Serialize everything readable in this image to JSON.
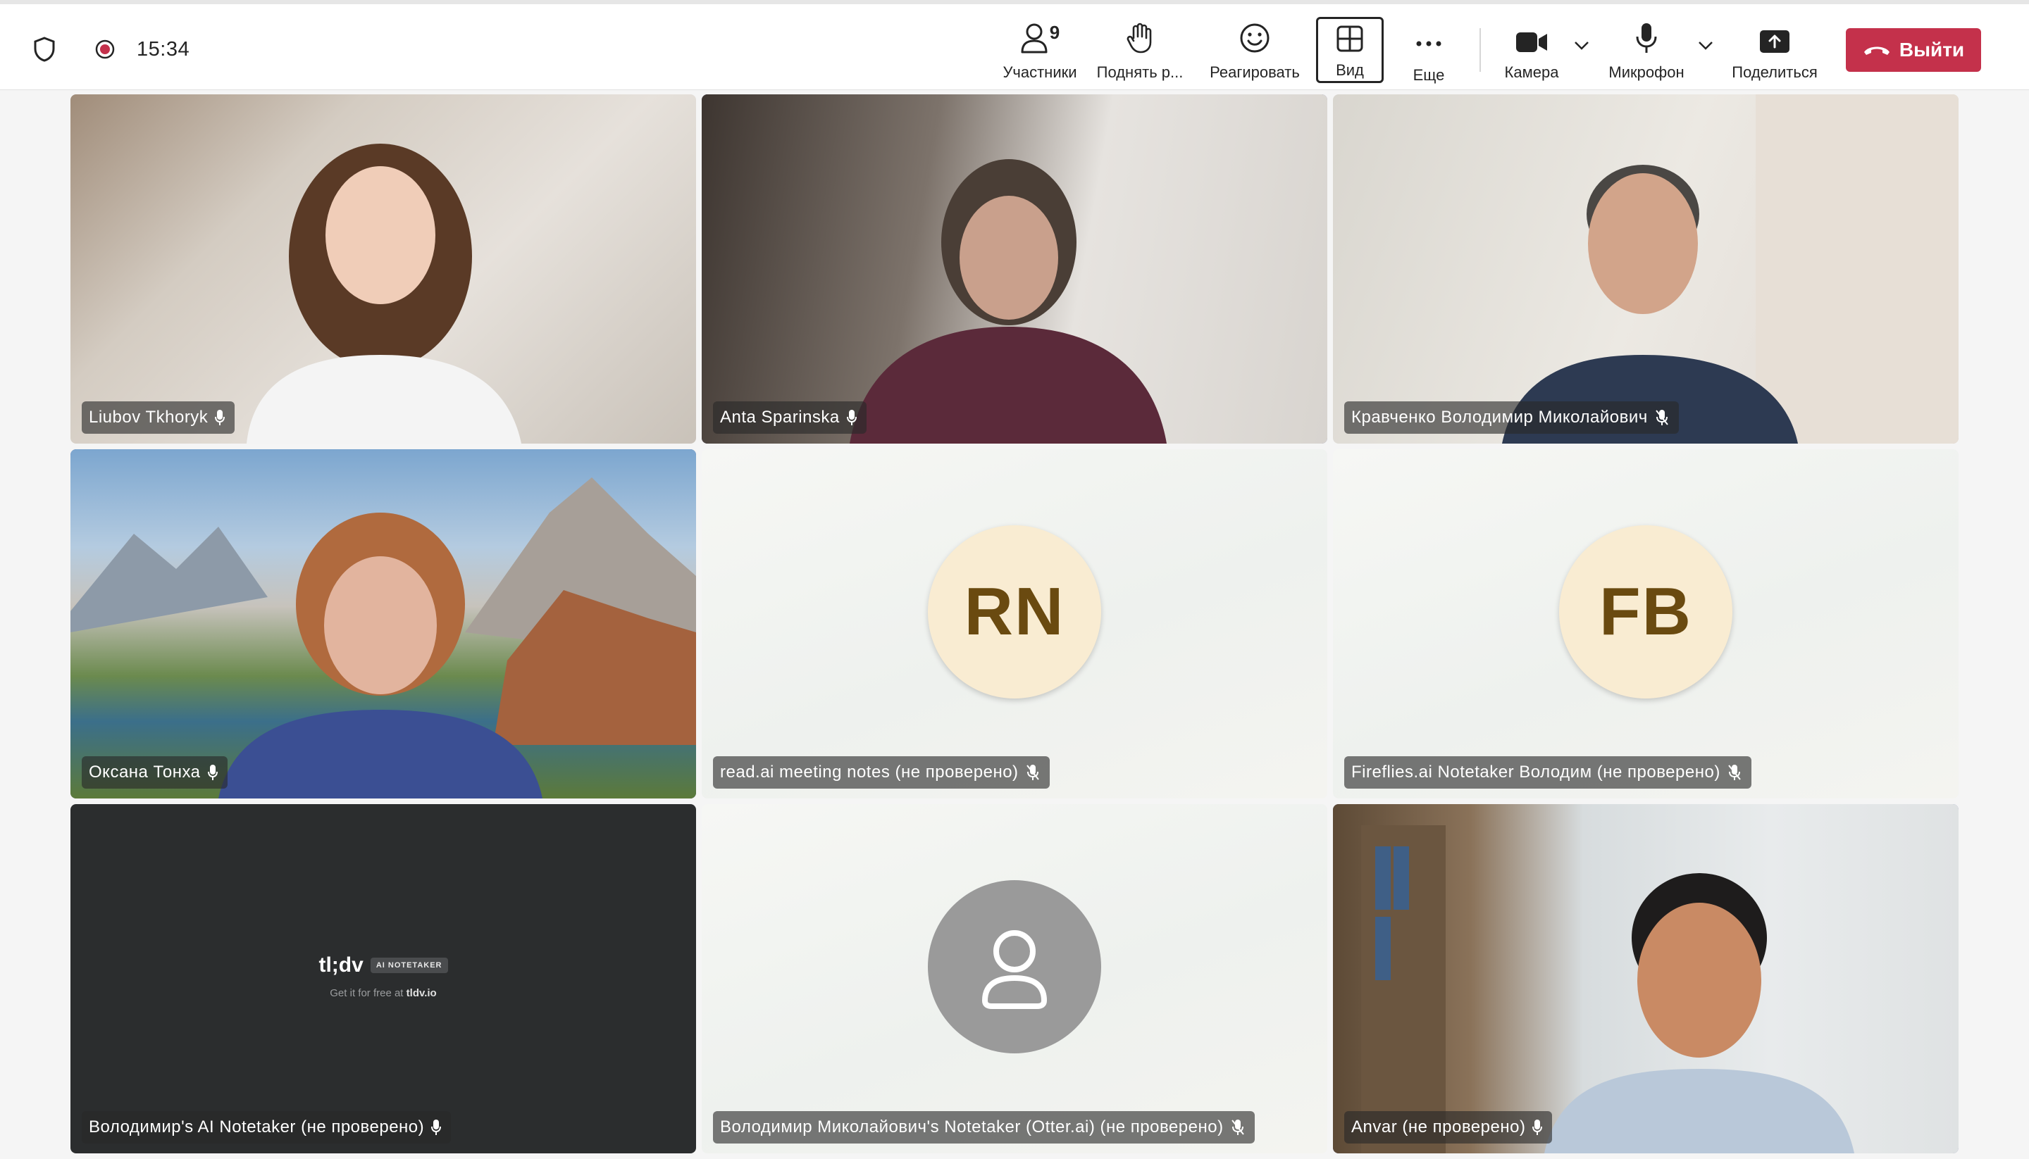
{
  "toolbar": {
    "time": "15:34",
    "participants": {
      "label": "Участники",
      "count": "9"
    },
    "raise_hand": {
      "label": "Поднять р..."
    },
    "react": {
      "label": "Реагировать"
    },
    "view": {
      "label": "Вид"
    },
    "more": {
      "label": "Еще"
    },
    "camera": {
      "label": "Камера"
    },
    "mic": {
      "label": "Микрофон"
    },
    "share": {
      "label": "Поделиться"
    },
    "leave": {
      "label": "Выйти"
    },
    "leave_color": "#c4314b"
  },
  "accent": "#6264a7",
  "tiles": [
    {
      "name": "Liubov Tkhoryk",
      "mic": "on",
      "kind": "video"
    },
    {
      "name": "Anta Sparinska",
      "mic": "on",
      "kind": "video",
      "active": true
    },
    {
      "name": "Кравченко Володимир Миколайович",
      "mic": "off",
      "kind": "video"
    },
    {
      "name": "Оксана Тонха",
      "mic": "on",
      "kind": "video",
      "active": true
    },
    {
      "name": "read.ai meeting notes (не проверено)",
      "mic": "off",
      "kind": "initials",
      "initials": "RN"
    },
    {
      "name": "Fireflies.ai Notetaker Володим (не проверено)",
      "mic": "off",
      "kind": "initials",
      "initials": "FB"
    },
    {
      "name": "Володимир's AI Notetaker (не проверено)",
      "mic": "on",
      "kind": "tldv"
    },
    {
      "name": "Володимир Миколайович's Notetaker (Otter.ai) (не проверено)",
      "mic": "off",
      "kind": "placeholder"
    },
    {
      "name": "Anvar (не проверено)",
      "mic": "on",
      "kind": "video",
      "active": true
    }
  ],
  "tldv": {
    "logo": "tl;dv",
    "badge": "AI NOTETAKER",
    "tagline": "Get it for free at",
    "site": "tldv.io"
  }
}
